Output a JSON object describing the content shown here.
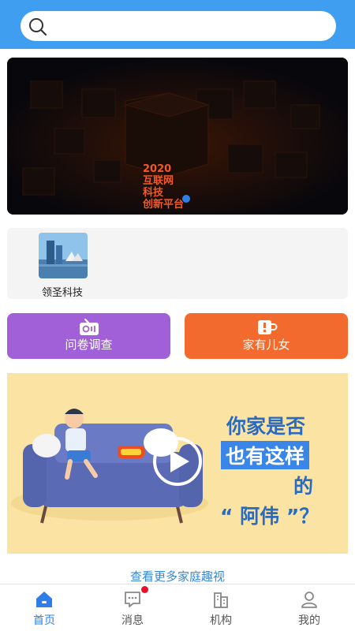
{
  "search": {
    "placeholder": ""
  },
  "banner": {
    "lines": [
      "2020",
      "互联网",
      "科技",
      "创新平台"
    ],
    "pages": 1,
    "active_page": 1
  },
  "orgs": [
    {
      "label": "领圣科技"
    }
  ],
  "actions": {
    "survey_label": "问卷调查",
    "family_label": "家有儿女"
  },
  "video": {
    "lines": [
      "你家是否",
      "也有这样",
      "的",
      "“ 阿伟 ”？"
    ]
  },
  "more_link": "查看更多家庭趣视",
  "tabbar": {
    "items": [
      {
        "label": "首页",
        "icon": "home-icon",
        "active": true
      },
      {
        "label": "消息",
        "icon": "message-icon",
        "active": false,
        "badge": true
      },
      {
        "label": "机构",
        "icon": "building-icon",
        "active": false
      },
      {
        "label": "我的",
        "icon": "user-icon",
        "active": false
      }
    ]
  },
  "colors": {
    "primary": "#3f9ef0",
    "survey": "#a160d8",
    "family": "#f36a2e",
    "active_tab": "#2f7ee8",
    "badge": "#e8112d"
  }
}
